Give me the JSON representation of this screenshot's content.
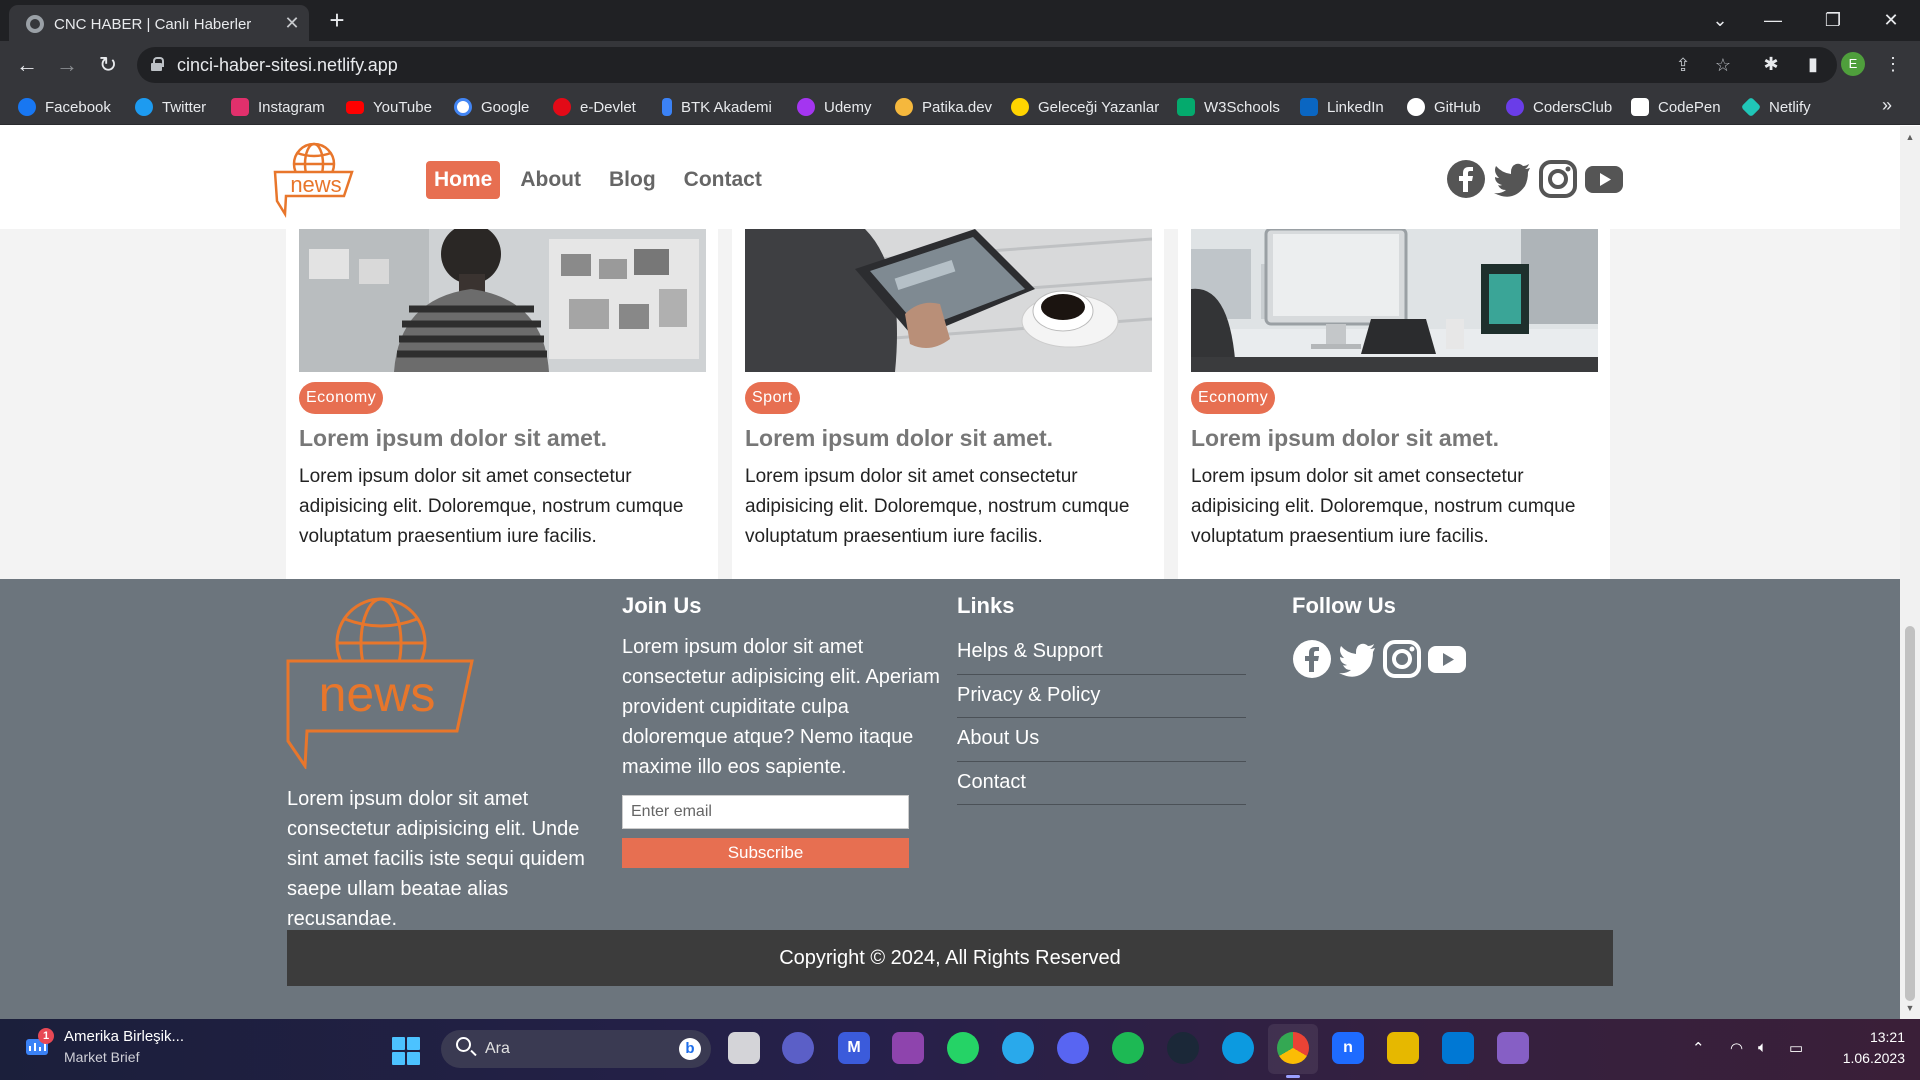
{
  "browser": {
    "tab_title": "CNC HABER | Canlı Haberler",
    "url": "cinci-haber-sitesi.netlify.app",
    "profile_initial": "E",
    "bookmarks": [
      {
        "label": "Facebook",
        "color": "#1877f2"
      },
      {
        "label": "Twitter",
        "color": "#1d9bf0"
      },
      {
        "label": "Instagram",
        "color": "#e1306c"
      },
      {
        "label": "YouTube",
        "color": "#ff0000"
      },
      {
        "label": "Google",
        "color": "#ffffff"
      },
      {
        "label": "e-Devlet",
        "color": "#e30a17"
      },
      {
        "label": "BTK Akademi",
        "color": "#3b82f6"
      },
      {
        "label": "Udemy",
        "color": "#a435f0"
      },
      {
        "label": "Patika.dev",
        "color": "#f5b83d"
      },
      {
        "label": "Geleceği Yazanlar",
        "color": "#ffd400"
      },
      {
        "label": "W3Schools",
        "color": "#04aa6d"
      },
      {
        "label": "LinkedIn",
        "color": "#0a66c2"
      },
      {
        "label": "GitHub",
        "color": "#ffffff"
      },
      {
        "label": "CodersClub",
        "color": "#6a3de8"
      },
      {
        "label": "CodePen",
        "color": "#ffffff"
      },
      {
        "label": "Netlify",
        "color": "#20c6b7"
      }
    ]
  },
  "site": {
    "logo_text": "news",
    "nav": [
      {
        "label": "Home",
        "active": true
      },
      {
        "label": "About",
        "active": false
      },
      {
        "label": "Blog",
        "active": false
      },
      {
        "label": "Contact",
        "active": false
      }
    ],
    "social_icons": [
      "facebook-icon",
      "twitter-icon",
      "instagram-icon",
      "youtube-icon"
    ],
    "accent_color": "#e76f51",
    "cards": [
      {
        "category": "Economy",
        "title": "Lorem ipsum dolor sit amet.",
        "text": "Lorem ipsum dolor sit amet consectetur adipisicing elit. Doloremque, nostrum cumque voluptatum praesentium iure facilis."
      },
      {
        "category": "Sport",
        "title": "Lorem ipsum dolor sit amet.",
        "text": "Lorem ipsum dolor sit amet consectetur adipisicing elit. Doloremque, nostrum cumque voluptatum praesentium iure facilis."
      },
      {
        "category": "Economy",
        "title": "Lorem ipsum dolor sit amet.",
        "text": "Lorem ipsum dolor sit amet consectetur adipisicing elit. Doloremque, nostrum cumque voluptatum praesentium iure facilis."
      }
    ],
    "footer": {
      "about_text": "Lorem ipsum dolor sit amet consectetur adipisicing elit. Unde sint amet facilis iste sequi quidem saepe ullam beatae alias recusandae.",
      "join_title": "Join Us",
      "join_text": "Lorem ipsum dolor sit amet consectetur adipisicing elit. Aperiam provident cupiditate culpa doloremque atque? Nemo itaque maxime illo eos sapiente.",
      "email_placeholder": "Enter email",
      "subscribe_label": "Subscribe",
      "links_title": "Links",
      "links": [
        "Helps & Support",
        "Privacy & Policy",
        "About Us",
        "Contact"
      ],
      "follow_title": "Follow Us",
      "copyright": "Copyright © 2024, All Rights Reserved"
    }
  },
  "taskbar": {
    "news_badge": "1",
    "news_title": "Amerika Birleşik...",
    "news_subtitle": "Market Brief",
    "search_label": "Ara",
    "time": "13:21",
    "date": "1.06.2023"
  }
}
